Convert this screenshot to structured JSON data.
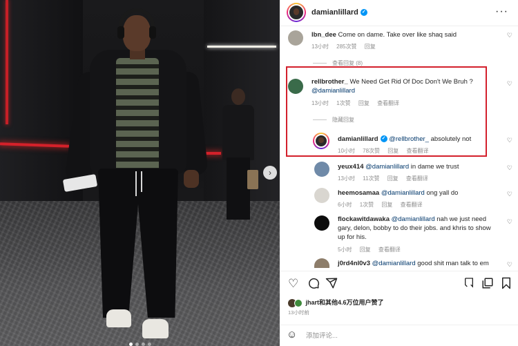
{
  "post": {
    "username": "damianlillard",
    "verified_icon": "verified-badge-icon",
    "more_icon": "more-horizontal-icon"
  },
  "comments": [
    {
      "user": "lbn_dee",
      "text": "Come on dame. Take over like shaq said",
      "time": "13小时",
      "likes": "285次赞",
      "reply": "回复",
      "view_replies": "查看回复 (8)"
    },
    {
      "user": "rellbrother_",
      "text": "We Need Get Rid Of Doc Don't We Bruh ?",
      "mention": "@damianlillard",
      "time": "13小时",
      "likes": "1次赞",
      "reply": "回复",
      "translate": "查看翻译",
      "hide_replies": "隐藏回复"
    },
    {
      "user": "damianlillard",
      "mention": "@rellbrother_",
      "text": "absolutely not",
      "time": "10小时",
      "likes": "78次赞",
      "reply": "回复",
      "translate": "查看翻译"
    },
    {
      "user": "yeux414",
      "mention": "@damianlillard",
      "text": "in dame we trust",
      "time": "13小时",
      "likes": "11次赞",
      "reply": "回复",
      "translate": "查看翻译"
    },
    {
      "user": "heemosamaa",
      "mention": "@damianlillard",
      "text": "ong yall do",
      "time": "6小时",
      "likes": "1次赞",
      "reply": "回复",
      "translate": "查看翻译"
    },
    {
      "user": "flockawitdawaka",
      "mention": "@damianlillard",
      "text": "nah we just need",
      "text2": "gary, delon, bobby to do their jobs. and khris to show",
      "text3": "up for his.",
      "time": "5小时",
      "reply": "回复",
      "translate": "查看翻译"
    },
    {
      "user": "j0rd4nl0v3",
      "mention": "@damianlillard",
      "text": "good shit man talk to em"
    }
  ],
  "liked_by": {
    "user": "jhart",
    "rest": "和其他4.6万位用户赞了"
  },
  "post_time": "13小时前",
  "composer": {
    "placeholder": "添加评论..."
  },
  "colors": {
    "highlight_border": "#d31f2b",
    "verified": "#0095f6",
    "mention": "#00376b",
    "meta": "#8e8e8e"
  },
  "icons": [
    "heart-icon",
    "comment-icon",
    "share-icon",
    "bookmark-icon",
    "emoji-icon",
    "next-arrow-icon"
  ]
}
